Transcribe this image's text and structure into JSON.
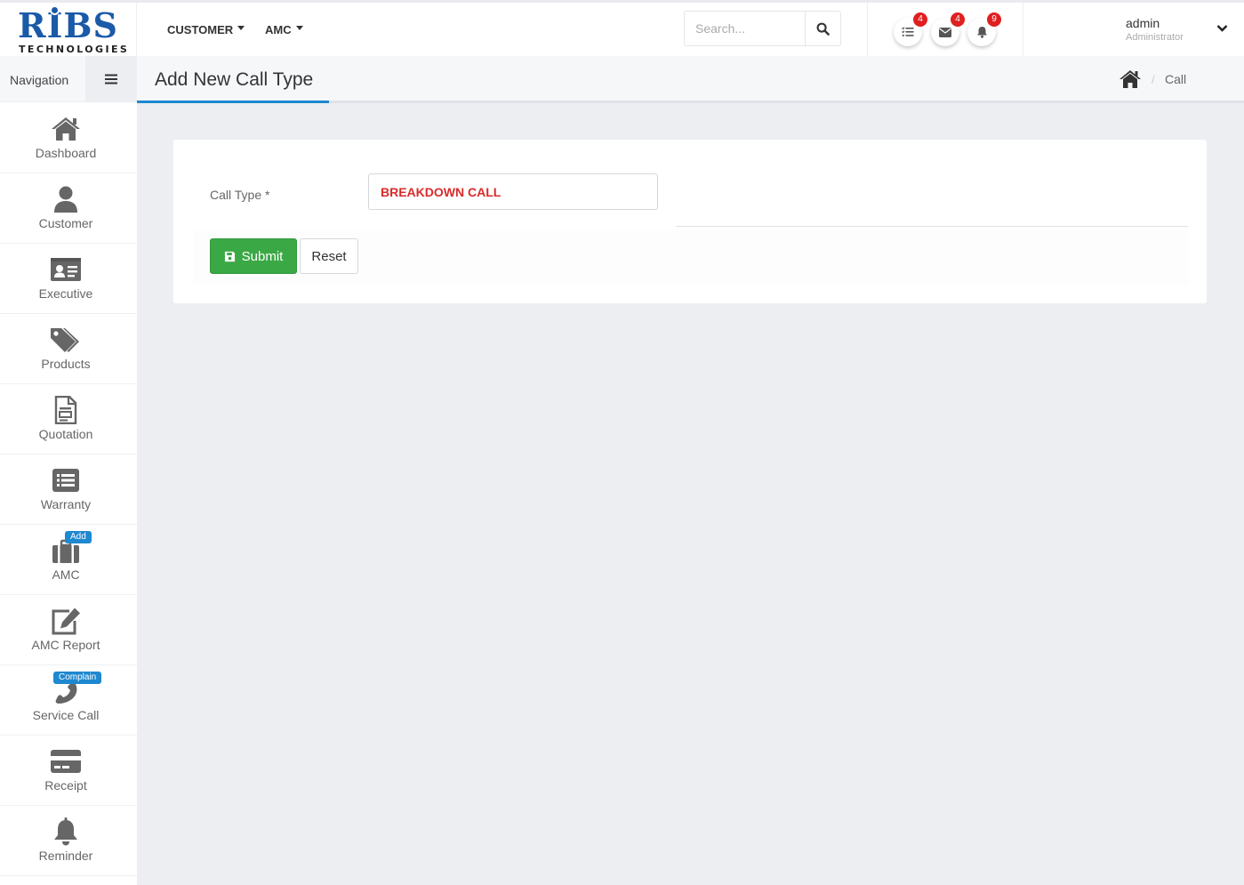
{
  "brand": {
    "name": "RIBS",
    "subtitle": "TECHNOLOGIES"
  },
  "topnav": [
    {
      "label": "CUSTOMER"
    },
    {
      "label": "AMC"
    }
  ],
  "search": {
    "placeholder": "Search..."
  },
  "notifications": [
    {
      "icon": "task-list-icon",
      "count": "4"
    },
    {
      "icon": "envelope-icon",
      "count": "4"
    },
    {
      "icon": "bell-icon",
      "count": "9"
    }
  ],
  "user": {
    "name": "admin",
    "role": "Administrator"
  },
  "sidebar": {
    "header": "Navigation",
    "items": [
      {
        "label": "Dashboard",
        "icon": "home-icon"
      },
      {
        "label": "Customer",
        "icon": "user-icon"
      },
      {
        "label": "Executive",
        "icon": "id-card-icon"
      },
      {
        "label": "Products",
        "icon": "tags-icon"
      },
      {
        "label": "Quotation",
        "icon": "document-icon"
      },
      {
        "label": "Warranty",
        "icon": "list-icon"
      },
      {
        "label": "AMC",
        "icon": "briefcase-icon",
        "tag": "Add"
      },
      {
        "label": "AMC Report",
        "icon": "edit-icon"
      },
      {
        "label": "Service Call",
        "icon": "phone-icon",
        "tag": "Complain"
      },
      {
        "label": "Receipt",
        "icon": "credit-card-icon"
      },
      {
        "label": "Reminder",
        "icon": "bell-icon"
      }
    ]
  },
  "page": {
    "title": "Add New Call Type",
    "breadcrumb_current": "Call"
  },
  "form": {
    "call_type_label": "Call Type *",
    "call_type_value": "BREAKDOWN CALL",
    "submit_label": "Submit",
    "reset_label": "Reset"
  },
  "colors": {
    "brand_blue": "#1a5aa8",
    "accent_blue": "#1e88d0",
    "success_green": "#3aa845",
    "badge_red": "#e02020",
    "input_text_red": "#d92b2b"
  }
}
